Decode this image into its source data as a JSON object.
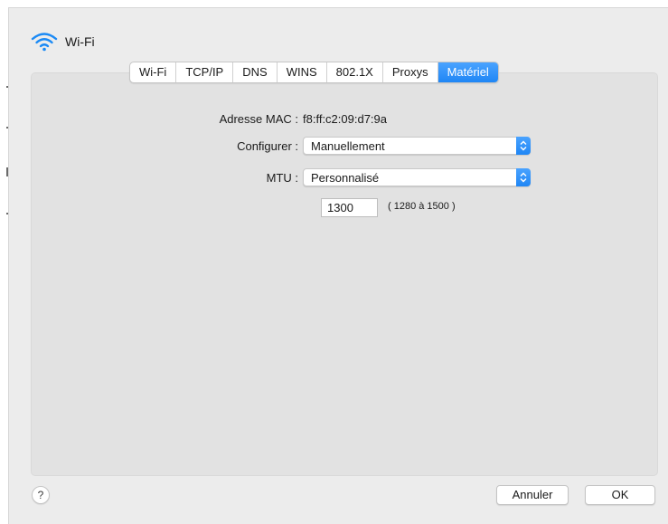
{
  "window": {
    "title": "Wi-Fi",
    "icon": "wifi-icon"
  },
  "tabs": [
    {
      "label": "Wi-Fi",
      "active": false
    },
    {
      "label": "TCP/IP",
      "active": false
    },
    {
      "label": "DNS",
      "active": false
    },
    {
      "label": "WINS",
      "active": false
    },
    {
      "label": "802.1X",
      "active": false
    },
    {
      "label": "Proxys",
      "active": false
    },
    {
      "label": "Matériel",
      "active": true
    }
  ],
  "hardware": {
    "mac_label": "Adresse MAC :",
    "mac_value": "f8:ff:c2:09:d7:9a",
    "configure_label": "Configurer :",
    "configure_value": "Manuellement",
    "mtu_label": "MTU :",
    "mtu_value": "Personnalisé",
    "mtu_custom_value": "1300",
    "mtu_range": "( 1280 à 1500 )"
  },
  "footer": {
    "help_label": "?",
    "cancel_label": "Annuler",
    "ok_label": "OK"
  },
  "colors": {
    "accent": "#1f86f5",
    "wifi_icon": "#1b8af5"
  }
}
